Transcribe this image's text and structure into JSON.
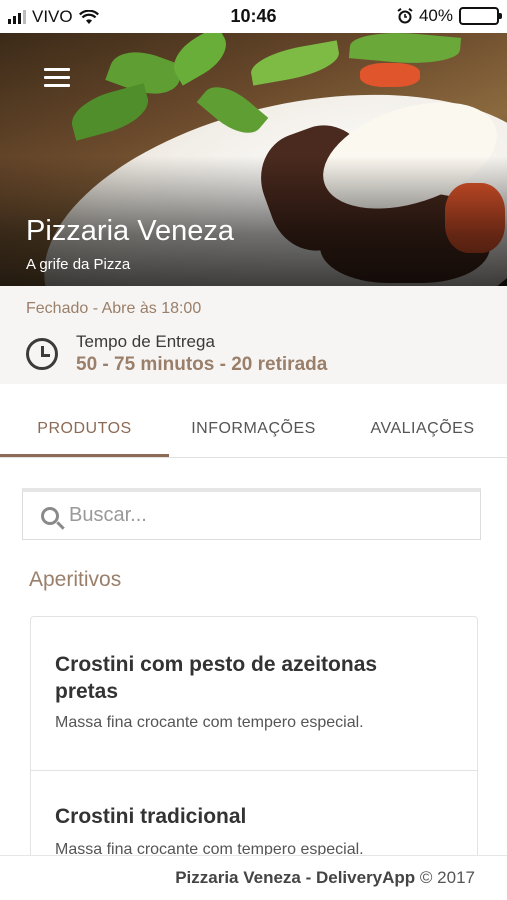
{
  "status_bar": {
    "carrier": "VIVO",
    "time": "10:46",
    "battery": "40%"
  },
  "hero": {
    "title": "Pizzaria Veneza",
    "subtitle": "A grife da Pizza"
  },
  "info": {
    "status": "Fechado - Abre às 18:00",
    "delivery_label": "Tempo de Entrega",
    "delivery_value": "50 - 75 minutos - 20 retirada"
  },
  "tabs": [
    {
      "label": "PRODUTOS"
    },
    {
      "label": "INFORMAÇÕES"
    },
    {
      "label": "AVALIAÇÕES"
    }
  ],
  "search": {
    "placeholder": "Buscar...",
    "value": ""
  },
  "section": {
    "title": "Aperitivos"
  },
  "products": [
    {
      "name": "Crostini com pesto de azeitonas pretas",
      "description": "Massa fina crocante com tempero especial."
    },
    {
      "name": "Crostini tradicional",
      "description": "Massa fina crocante com tempero especial."
    }
  ],
  "footer": {
    "brand": "Pizzaria Veneza - DeliveryApp",
    "copyright": "© 2017"
  },
  "colors": {
    "accent": "#8c6a55",
    "muted_accent": "#9a7f6a"
  }
}
